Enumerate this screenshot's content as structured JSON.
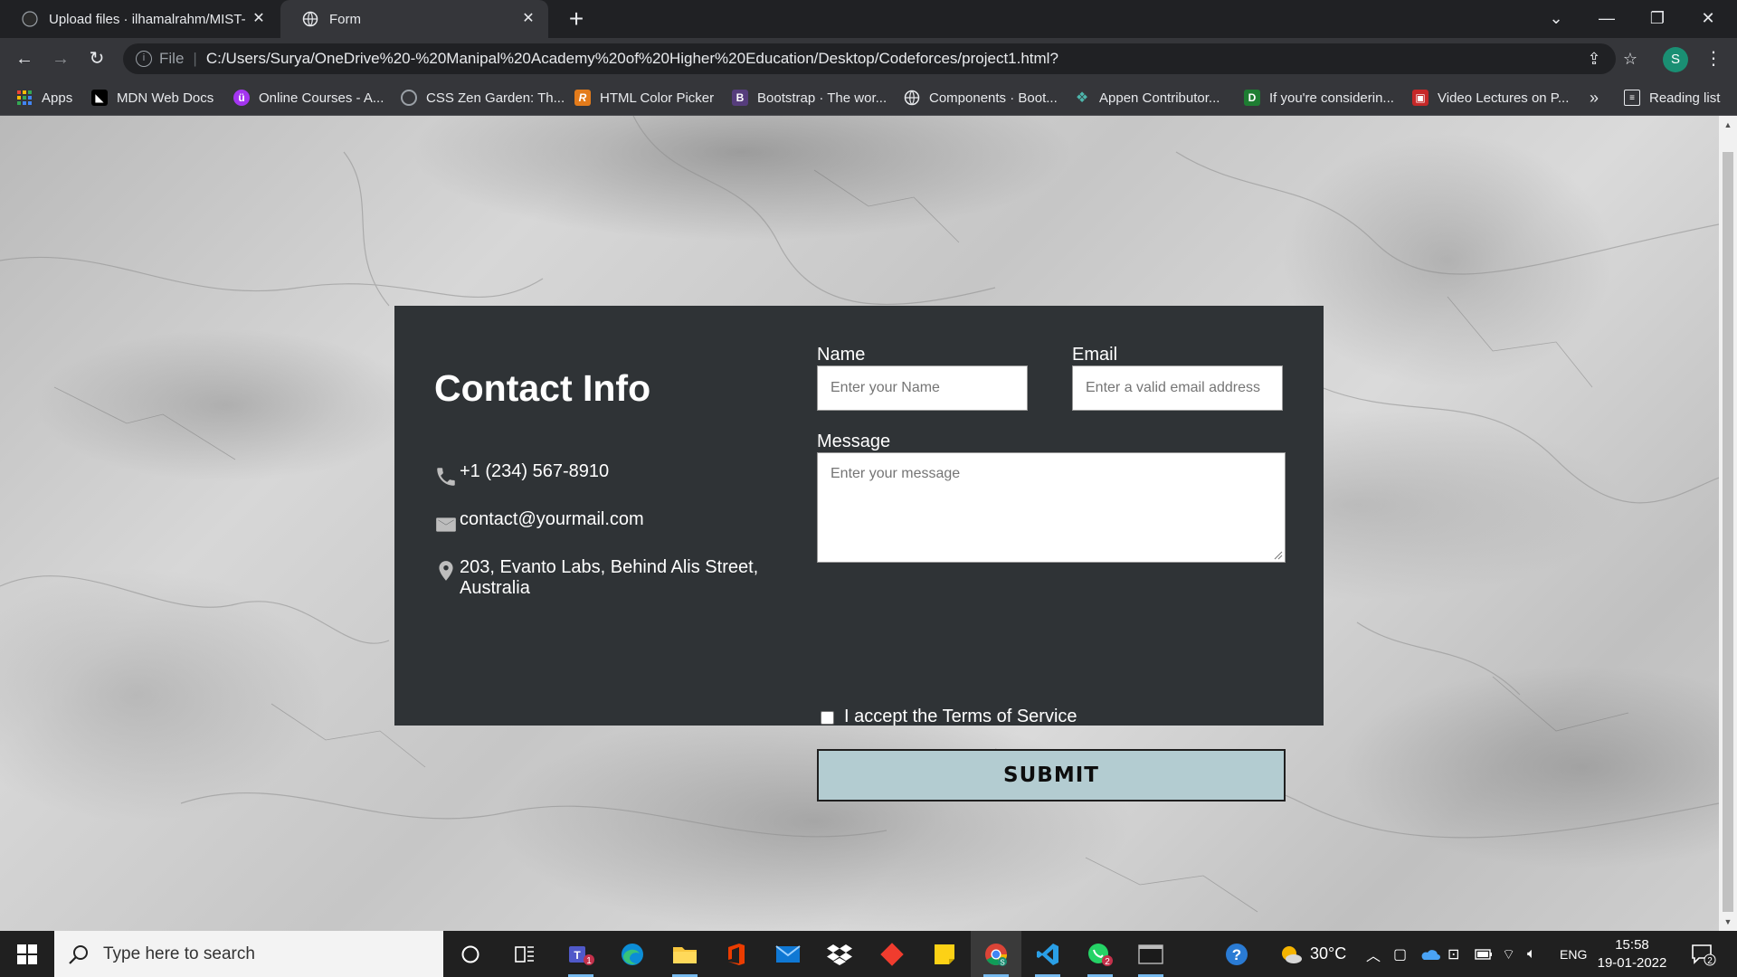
{
  "browser": {
    "tabs": [
      {
        "title": "Upload files · ilhamalrahm/MIST-",
        "icon": "github-icon"
      },
      {
        "title": "Form",
        "icon": "globe-icon"
      }
    ],
    "address_bar": {
      "scheme_label": "File",
      "url": "C:/Users/Surya/OneDrive%20-%20Manipal%20Academy%20of%20Higher%20Education/Desktop/Codeforces/project1.html?"
    },
    "profile_initial": "S",
    "bookmarks": [
      {
        "label": "Apps",
        "icon": "apps-grid-icon"
      },
      {
        "label": "MDN Web Docs",
        "icon": "mdn-icon"
      },
      {
        "label": "Online Courses - A...",
        "icon": "udemy-icon"
      },
      {
        "label": "CSS Zen Garden: Th...",
        "icon": "zen-garden-icon"
      },
      {
        "label": "HTML Color Picker",
        "icon": "color-picker-icon"
      },
      {
        "label": "Bootstrap · The wor...",
        "icon": "bootstrap-icon"
      },
      {
        "label": "Components · Boot...",
        "icon": "globe-icon"
      },
      {
        "label": "Appen Contributor...",
        "icon": "appen-icon"
      },
      {
        "label": "If you're considerin...",
        "icon": "bookmark-green-icon"
      },
      {
        "label": "Video Lectures on P...",
        "icon": "video-lectures-icon"
      }
    ],
    "overflow_label": "»",
    "reading_list_label": "Reading list"
  },
  "contact": {
    "title": "Contact Info",
    "phone": "+1 (234) 567-8910",
    "email": "contact@yourmail.com",
    "address": "203, Evanto Labs, Behind Alis Street, Australia"
  },
  "form": {
    "name_label": "Name",
    "name_placeholder": "Enter your Name",
    "email_label": "Email",
    "email_placeholder": "Enter a valid email address",
    "message_label": "Message",
    "message_placeholder": "Enter your message",
    "terms_label": "I accept the Terms of Service",
    "terms_checked": false,
    "submit_label": "SUBMIT"
  },
  "taskbar": {
    "search_placeholder": "Type here to search",
    "apps": [
      "cortana-icon",
      "task-view-icon",
      "teams-icon",
      "edge-icon",
      "file-explorer-icon",
      "office-icon",
      "mail-icon",
      "dropbox-icon",
      "git-icon",
      "sticky-notes-icon",
      "chrome-icon",
      "vscode-icon",
      "whatsapp-icon",
      "terminal-icon"
    ],
    "teams_badge": "1",
    "whatsapp_badge": "2",
    "chrome_badge": "S",
    "weather": "30°C",
    "language": "ENG",
    "time": "15:58",
    "date": "19-01-2022",
    "notification_count": "2"
  },
  "colors": {
    "card_bg": "#2f3336",
    "submit_bg": "#b3ccd1",
    "browser_frame": "#202124",
    "toolbar": "#35363a"
  }
}
